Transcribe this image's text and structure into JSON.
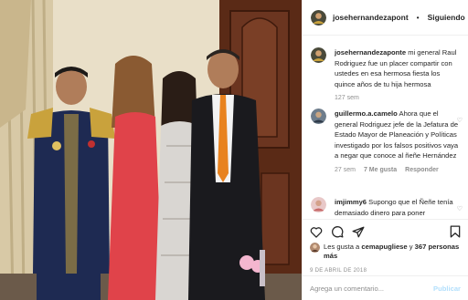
{
  "header": {
    "username": "josehernandezapont",
    "separator": "•",
    "follow_label": "Siguiendo",
    "more_label": "•••"
  },
  "caption": {
    "username": "josehernandezaponte",
    "text": "mi general Raul Rodriguez fue un placer compartir con ustedes en esa hermosa fiesta los quince años de tu hija hermosa",
    "time": "127 sem"
  },
  "comments": [
    {
      "username": "guillermo.a.camelo",
      "text": "Ahora que el general Rodriguez jefe de la Jefatura de Estado Mayor de Planeación y Políticas investigado por los falsos positivos vaya a negar que conoce al ñeñe Hernández",
      "time": "27 sem",
      "likes": "7 Me gusta",
      "reply": "Responder",
      "heart": "♡"
    },
    {
      "username": "imjimmy6",
      "text": "Supongo que el Ñeñe tenía demasiado dinero para poner",
      "heart": "♡"
    }
  ],
  "likes": {
    "prefix": "Les gusta a",
    "user": "cemapugliese",
    "connector": "y",
    "others": "367 personas más"
  },
  "date": "9 DE ABRIL DE 2018",
  "add_comment": {
    "placeholder": "Agrega un comentario...",
    "post_label": "Publicar"
  },
  "colors": {
    "text": "#262626",
    "secondary": "#8e8e8e",
    "border": "#efefef",
    "post_disabled": "#b2dffc"
  }
}
